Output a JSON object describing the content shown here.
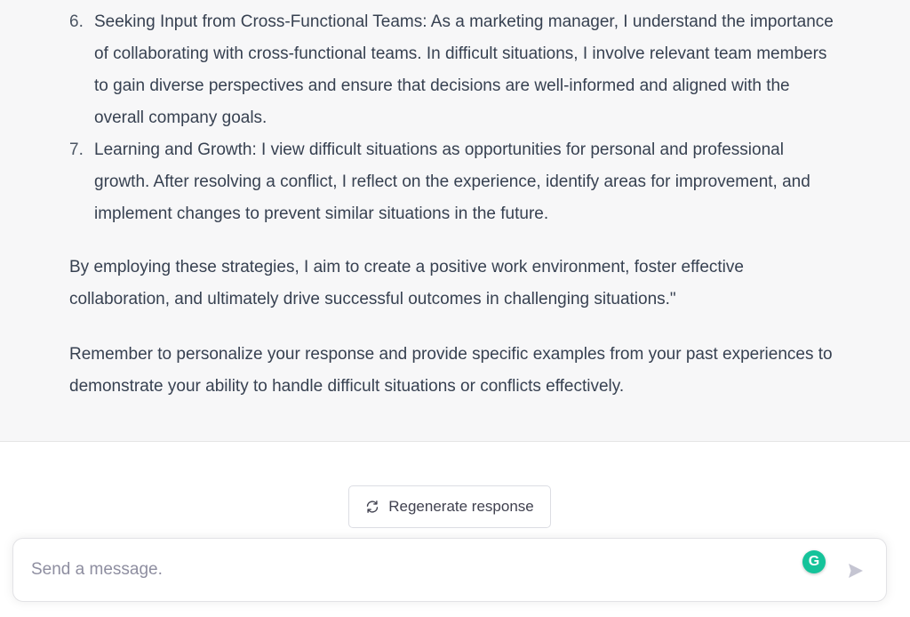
{
  "response": {
    "list_items": [
      {
        "number": "6.",
        "text": "Seeking Input from Cross-Functional Teams: As a marketing manager, I understand the importance of collaborating with cross-functional teams. In difficult situations, I involve relevant team members to gain diverse perspectives and ensure that decisions are well-informed and aligned with the overall company goals."
      },
      {
        "number": "7.",
        "text": "Learning and Growth: I view difficult situations as opportunities for personal and professional growth. After resolving a conflict, I reflect on the experience, identify areas for improvement, and implement changes to prevent similar situations in the future."
      }
    ],
    "closing_paragraph": "By employing these strategies, I aim to create a positive work environment, foster effective collaboration, and ultimately drive successful outcomes in challenging situations.\"",
    "reminder_paragraph": "Remember to personalize your response and provide specific examples from your past experiences to demonstrate your ability to handle difficult situations or conflicts effectively."
  },
  "actions": {
    "regenerate_label": "Regenerate response",
    "regenerate_icon": "refresh-icon"
  },
  "composer": {
    "placeholder": "Send a message.",
    "value": "",
    "grammarly_icon": "grammarly-icon",
    "grammarly_letter": "G",
    "send_icon": "send-icon"
  },
  "colors": {
    "response_bg": "#f7f7f8",
    "text": "#374151",
    "grammarly_green": "#15c39a",
    "send_disabled": "#c5c5d2"
  }
}
